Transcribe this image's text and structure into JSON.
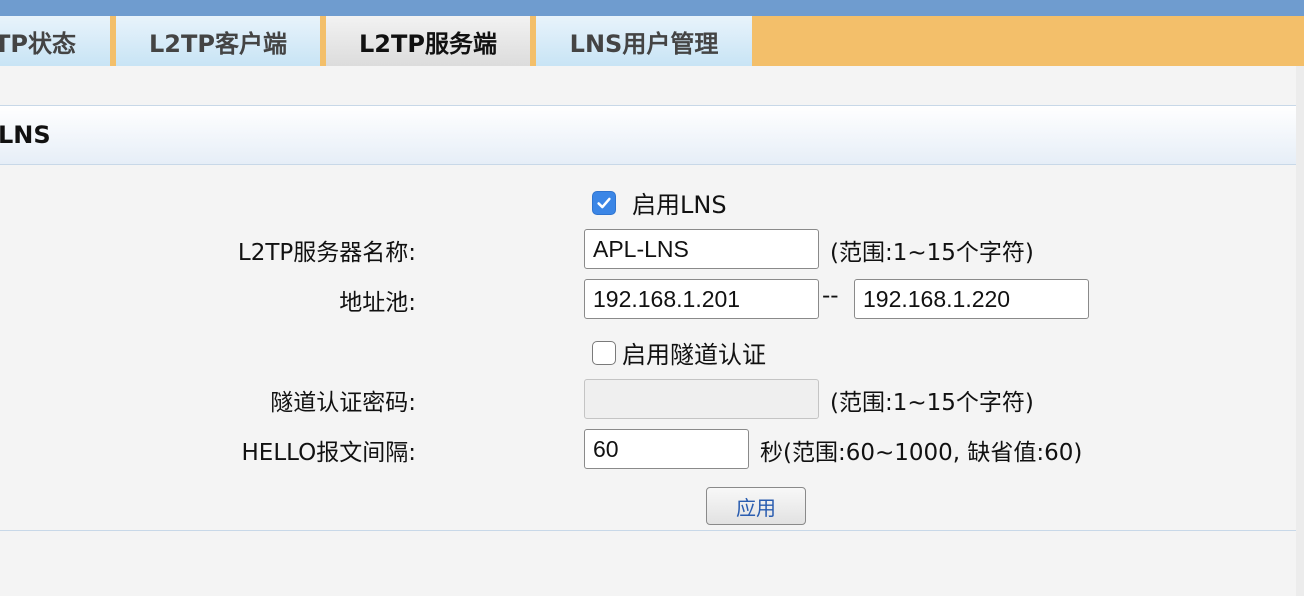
{
  "tabs": [
    {
      "label": "TP状态",
      "active": false
    },
    {
      "label": "L2TP客户端",
      "active": false
    },
    {
      "label": "L2TP服务端",
      "active": true
    },
    {
      "label": "LNS用户管理",
      "active": false
    }
  ],
  "section": {
    "title": "LNS"
  },
  "form": {
    "enable_lns": {
      "label": "启用LNS",
      "checked": true
    },
    "server_name": {
      "label": "L2TP服务器名称:",
      "value": "APL-LNS",
      "hint": "(范围:1~15个字符)"
    },
    "address_pool": {
      "label": "地址池:",
      "start": "192.168.1.201",
      "separator": "--",
      "end": "192.168.1.220"
    },
    "enable_tunnel_auth": {
      "label": "启用隧道认证",
      "checked": false
    },
    "tunnel_password": {
      "label": "隧道认证密码:",
      "value": "",
      "hint": "(范围:1~15个字符)"
    },
    "hello_interval": {
      "label": "HELLO报文间隔:",
      "value": "60",
      "hint": "秒(范围:60~1000, 缺省值:60)"
    },
    "apply_label": "应用"
  },
  "colors": {
    "top_strip": "#6f9ccf",
    "tabbar_bg": "#f3bf6a",
    "checkbox_checked": "#3b86e6",
    "apply_text": "#2a5db0"
  },
  "icons": {
    "checkmark": "checkmark-icon"
  }
}
